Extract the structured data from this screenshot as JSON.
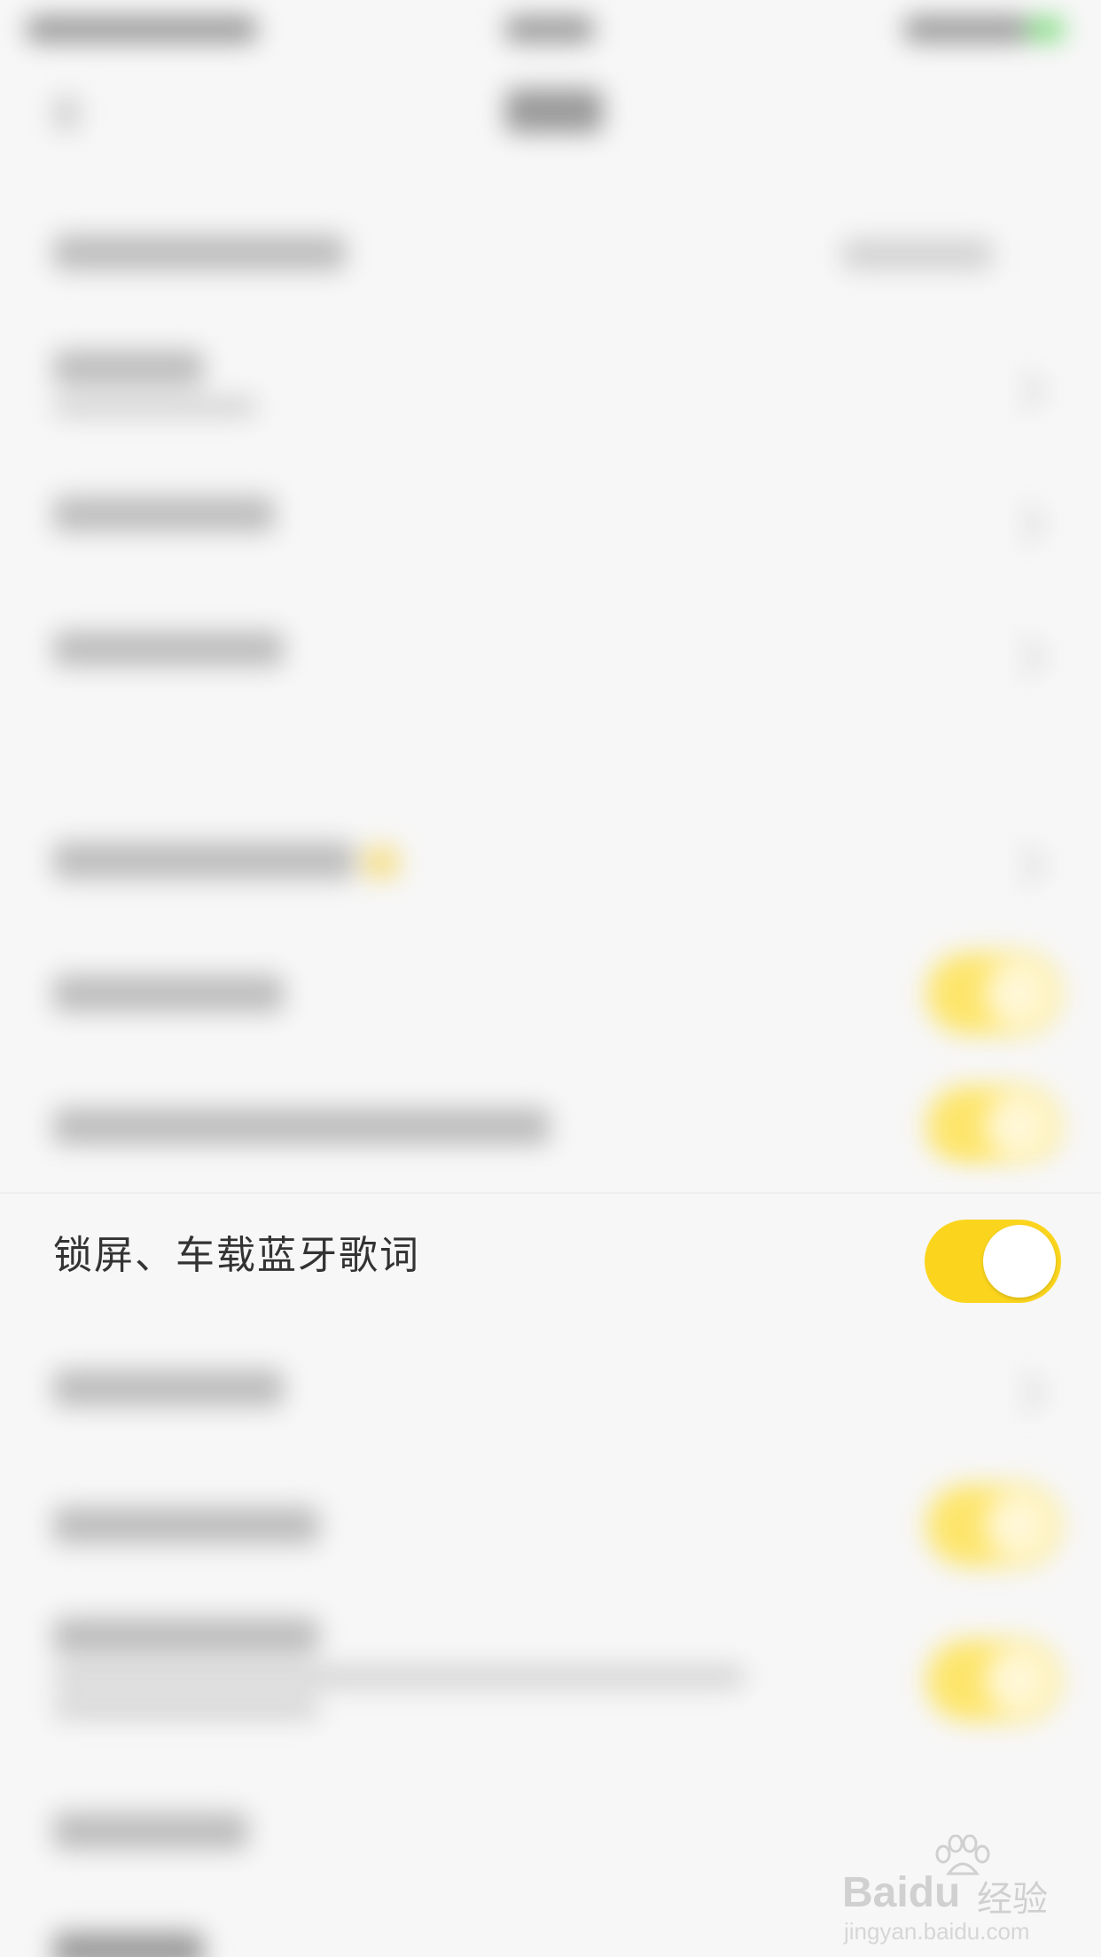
{
  "focused_setting": {
    "label": "锁屏、车载蓝牙歌词",
    "enabled": true
  },
  "colors": {
    "background": "#f7f7f7",
    "toggle_on": "#fbd51d",
    "toggle_knob": "#ffffff",
    "label_text": "#333333"
  },
  "icons": {
    "watermark_logo": "baidu-paw-icon"
  },
  "watermark": {
    "brand": "Baidu",
    "cn": "经验",
    "url": "jingyan.baidu.com"
  }
}
